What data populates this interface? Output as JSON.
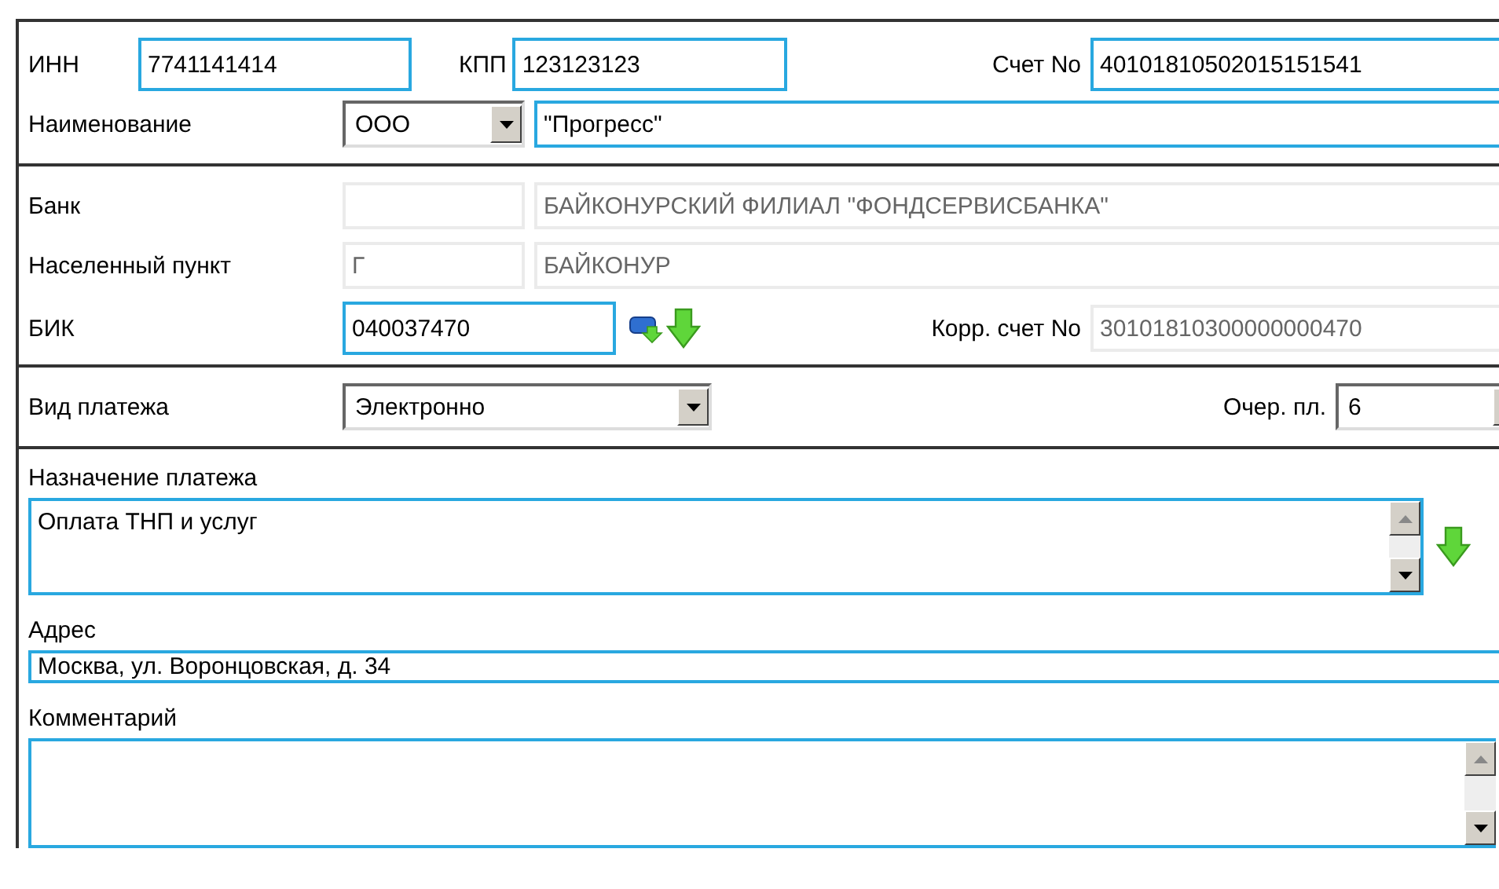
{
  "requisites": {
    "inn": {
      "label": "ИНН",
      "value": "7741141414"
    },
    "kpp": {
      "label": "КПП",
      "value": "123123123"
    },
    "account": {
      "label": "Счет No",
      "value": "40101810502015151541"
    },
    "name": {
      "label": "Наименование",
      "form": "ООО",
      "value": "\"Прогресс\""
    }
  },
  "bank": {
    "bank": {
      "label": "Банк",
      "code": {
        "disabled": true
      },
      "name": {
        "value": "БАЙКОНУРСКИЙ ФИЛИАЛ \"ФОНДСЕРВИСБАНКА\"",
        "disabled": true
      }
    },
    "locality": {
      "label": "Населенный пункт",
      "type": {
        "value": "Г",
        "disabled": true
      },
      "name": {
        "value": "БАЙКОНУР",
        "disabled": true
      }
    },
    "bik": {
      "label": "БИК",
      "value": "040037470",
      "disabled": false
    },
    "corr_account": {
      "label": "Корр. счет No",
      "value": "30101810300000000470",
      "disabled": true
    }
  },
  "payment": {
    "type": {
      "label": "Вид платежа",
      "value": "Электронно"
    },
    "priority": {
      "label": "Очер. пл.",
      "value": "6"
    }
  },
  "purpose": {
    "label": "Назначение платежа",
    "value": "Оплата ТНП и услуг"
  },
  "address": {
    "label": "Адрес",
    "value": "Москва, ул. Воронцовская, д. 34"
  },
  "comment": {
    "label": "Комментарий"
  }
}
